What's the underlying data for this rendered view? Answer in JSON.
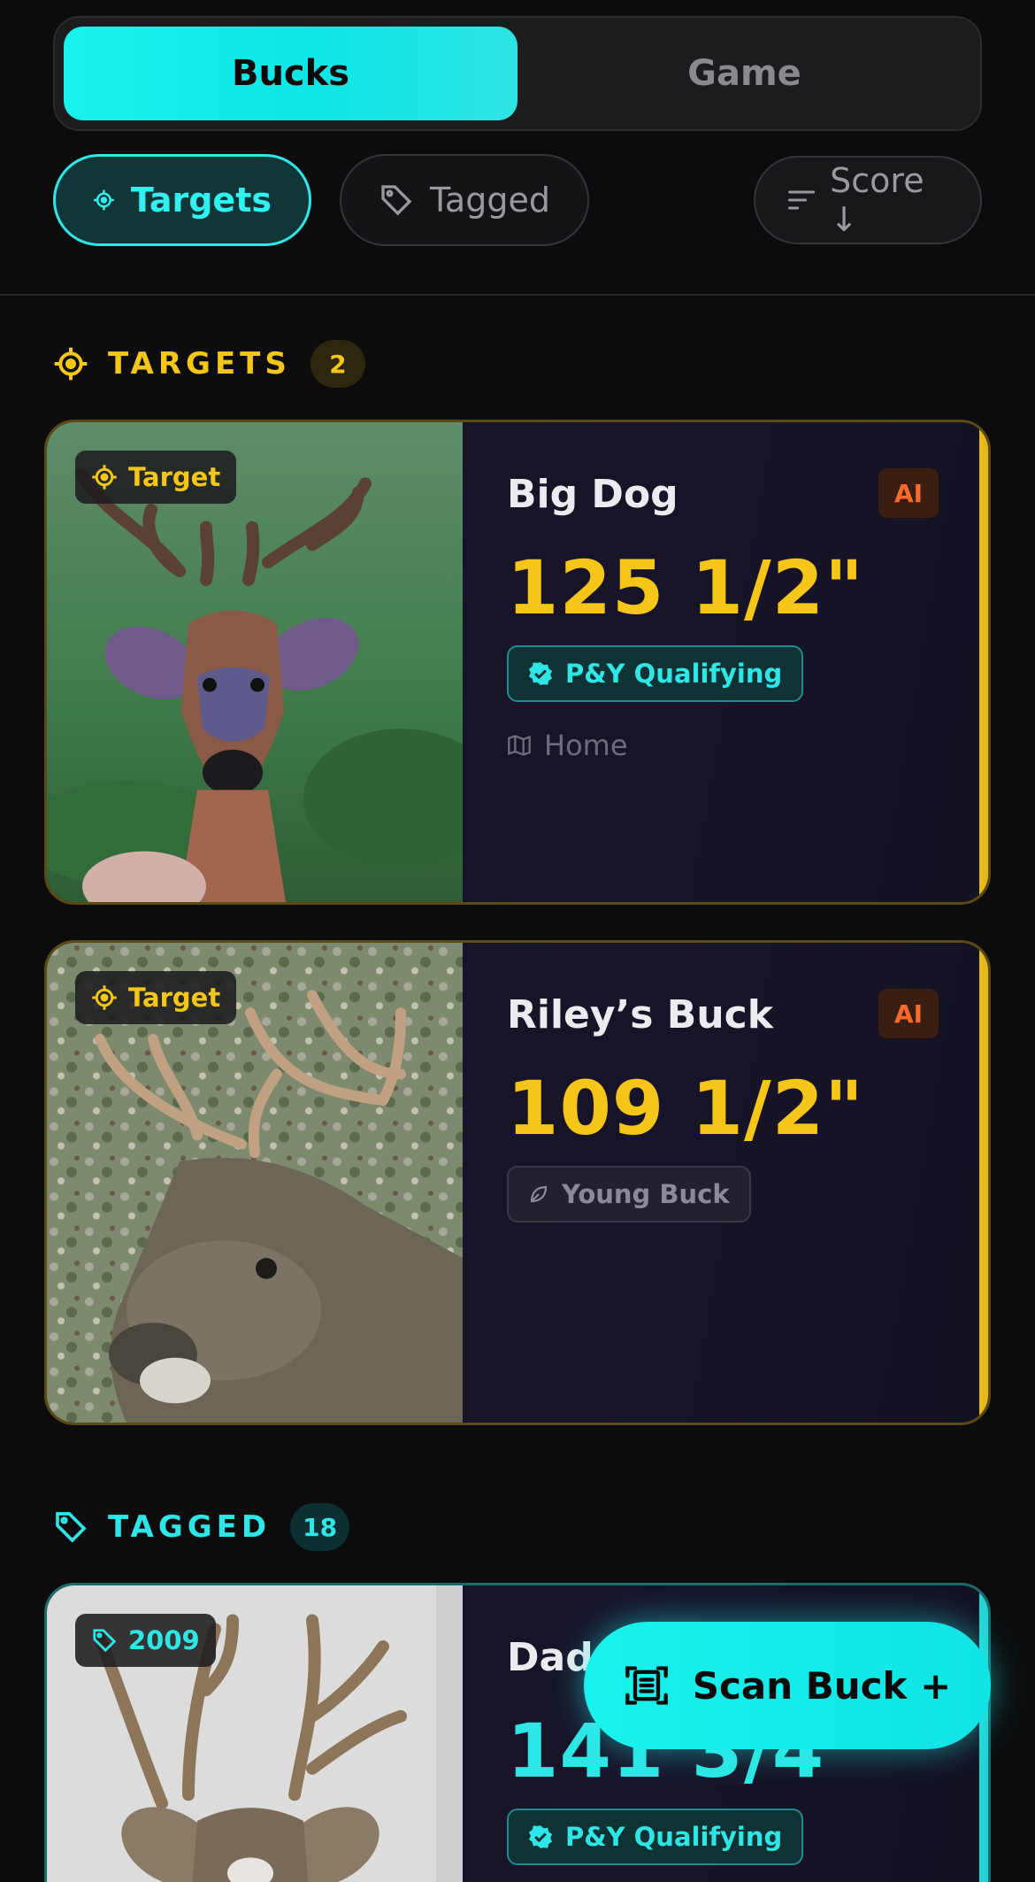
{
  "segments": {
    "bucks": "Bucks",
    "game": "Game"
  },
  "filters": {
    "targets": "Targets",
    "tagged": "Tagged",
    "sort": "Score ↓"
  },
  "sections": {
    "targets": {
      "title": "TARGETS",
      "count": "2"
    },
    "tagged": {
      "title": "TAGGED",
      "count": "18"
    }
  },
  "cards": [
    {
      "photo_badge": "Target",
      "name": "Big Dog",
      "ai": "AI",
      "score": "125 1/2\"",
      "status": "P&Y Qualifying",
      "location": "Home"
    },
    {
      "photo_badge": "Target",
      "name": "Riley’s Buck",
      "ai": "AI",
      "score": "109 1/2\"",
      "status": "Young Buck"
    },
    {
      "photo_badge": "2009",
      "name": "Dad",
      "score": "141 3/4",
      "status": "P&Y Qualifying"
    }
  ],
  "fab": {
    "label": "Scan Buck +"
  },
  "colors": {
    "accent": "#19f2ec",
    "gold": "#f5c518",
    "ai": "#ff6a2b"
  }
}
